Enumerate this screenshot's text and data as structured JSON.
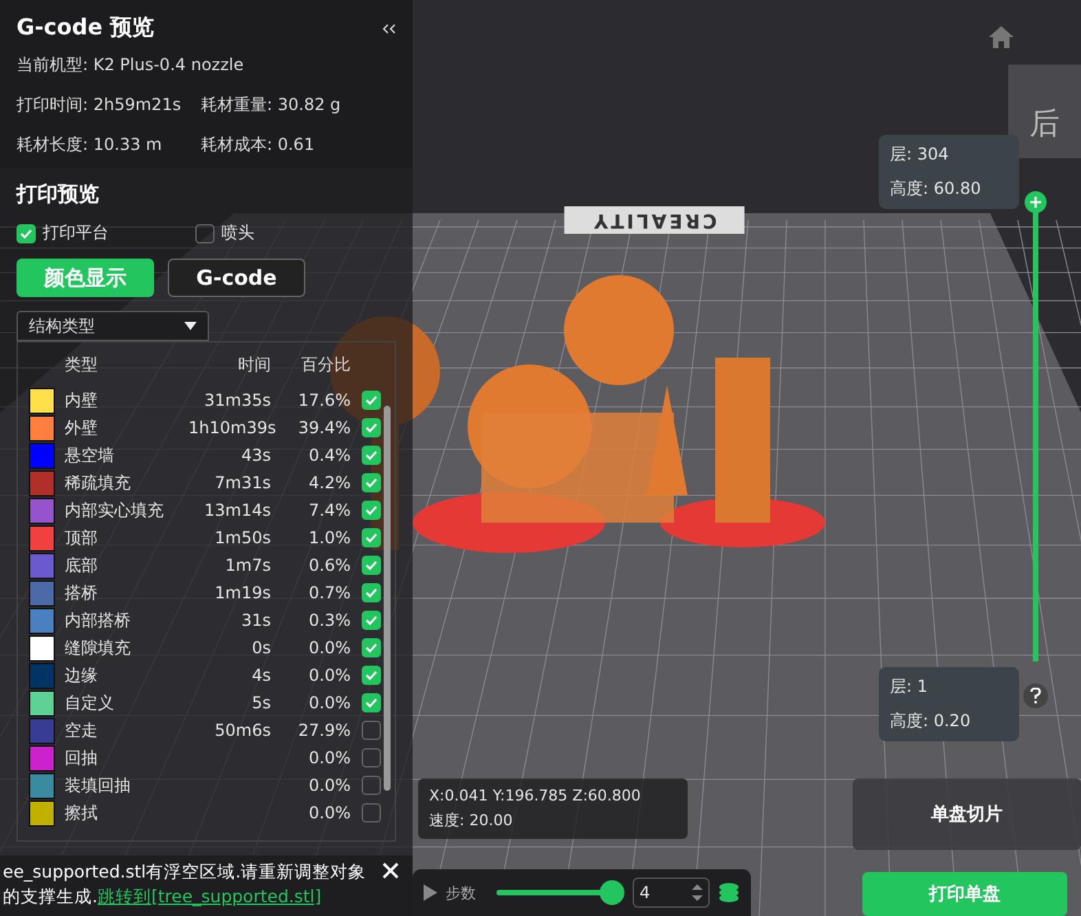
{
  "panel": {
    "title": "G-code 预览",
    "machine": "当前机型: K2 Plus-0.4 nozzle",
    "stats": [
      "打印时间: 2h59m21s",
      "耗材重量: 30.82 g",
      "耗材长度: 10.33 m",
      "耗材成本: 0.61"
    ],
    "section_title": "打印预览",
    "options": [
      {
        "label": "打印平台",
        "checked": true
      },
      {
        "label": "喷头",
        "checked": false
      }
    ],
    "modes": [
      {
        "label": "颜色显示",
        "selected": true
      },
      {
        "label": "G-code",
        "selected": false
      }
    ],
    "view_select": "结构类型",
    "columns": [
      "类型",
      "时间",
      "百分比"
    ],
    "rows": [
      {
        "name": "内壁",
        "time": "31m35s",
        "percent": "17.6%",
        "color": "#ffe04a",
        "checked": true
      },
      {
        "name": "外壁",
        "time": "1h10m39s",
        "percent": "39.4%",
        "color": "#ff7f3f",
        "checked": true
      },
      {
        "name": "悬空墙",
        "time": "43s",
        "percent": "0.4%",
        "color": "#0000ff",
        "checked": true
      },
      {
        "name": "稀疏填充",
        "time": "7m31s",
        "percent": "4.2%",
        "color": "#b03029",
        "checked": true
      },
      {
        "name": "内部实心填充",
        "time": "13m14s",
        "percent": "7.4%",
        "color": "#9654cc",
        "checked": true
      },
      {
        "name": "顶部",
        "time": "1m50s",
        "percent": "1.0%",
        "color": "#f04040",
        "checked": true
      },
      {
        "name": "底部",
        "time": "1m7s",
        "percent": "0.6%",
        "color": "#6a5acd",
        "checked": true
      },
      {
        "name": "搭桥",
        "time": "1m19s",
        "percent": "0.7%",
        "color": "#4d6aa8",
        "checked": true
      },
      {
        "name": "内部搭桥",
        "time": "31s",
        "percent": "0.3%",
        "color": "#4a80c0",
        "checked": true
      },
      {
        "name": "缝隙填充",
        "time": "0s",
        "percent": "0.0%",
        "color": "#ffffff",
        "checked": true
      },
      {
        "name": "边缘",
        "time": "4s",
        "percent": "0.0%",
        "color": "#003366",
        "checked": true
      },
      {
        "name": "自定义",
        "time": "5s",
        "percent": "0.0%",
        "color": "#5ed194",
        "checked": true
      },
      {
        "name": "空走",
        "time": "50m6s",
        "percent": "27.9%",
        "color": "#383c94",
        "checked": false
      },
      {
        "name": "回抽",
        "percent": "0.0%",
        "color": "#cc22cc",
        "checked": false
      },
      {
        "name": "装填回抽",
        "percent": "0.0%",
        "color": "#3a8aa0",
        "checked": false
      },
      {
        "name": "擦拭",
        "percent": "0.0%",
        "color": "#c0b000",
        "checked": false
      }
    ]
  },
  "plate_logo": "CREALITY",
  "view_cube": {
    "face": "后"
  },
  "layer_slider": {
    "level": 1,
    "top": {
      "layer": "层: 304",
      "height": "高度: 60.80"
    },
    "bottom": {
      "layer": "层: 1",
      "height": "高度: 0.20"
    }
  },
  "coordinates": {
    "position": "X:0.041 Y:196.785 Z:60.800",
    "speed": "速度: 20.00"
  },
  "notification": {
    "text": "ee_supported.stl有浮空区域.请重新调整对象的支撑生成.",
    "link": "跳转到[tree_supported.stl]"
  },
  "step_slider": {
    "label": "步数",
    "level": 1,
    "value": "4"
  },
  "buttons": [
    {
      "label": "单盘切片",
      "kind": "secondary"
    },
    {
      "label": "打印单盘",
      "kind": "primary"
    }
  ]
}
